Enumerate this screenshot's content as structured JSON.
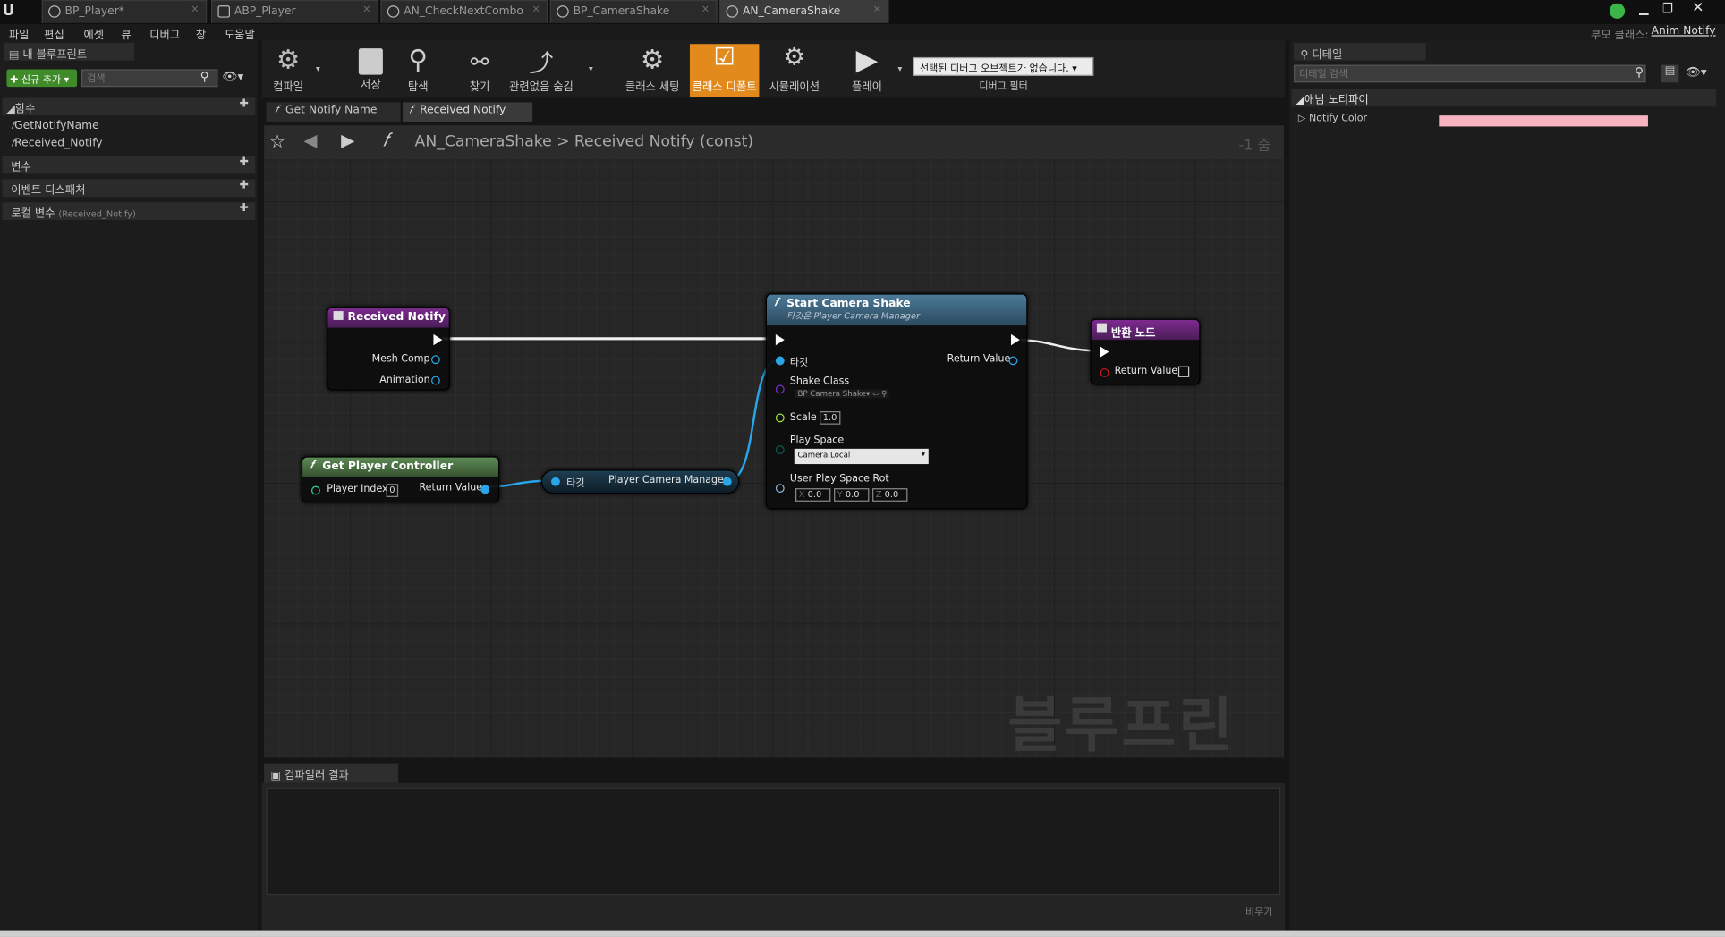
{
  "tabs": [
    {
      "label": "BP_Player*"
    },
    {
      "label": "ABP_Player"
    },
    {
      "label": "AN_CheckNextCombo"
    },
    {
      "label": "BP_CameraShake"
    },
    {
      "label": "AN_CameraShake"
    }
  ],
  "parent_class_label": "부모 클래스:",
  "parent_class_value": "Anim Notify",
  "menu": [
    "파일",
    "편집",
    "에셋",
    "뷰",
    "디버그",
    "창",
    "도움말"
  ],
  "my_blueprint": {
    "title": "내 블루프린트",
    "add_new": "신규 추가",
    "search_placeholder": "검색",
    "functions_label": "함수",
    "functions": [
      "GetNotifyName",
      "Received_Notify"
    ],
    "variables_label": "변수",
    "dispatchers_label": "이벤트 디스패처",
    "local_vars_label": "로컬 변수",
    "local_vars_scope": "(Received_Notify)"
  },
  "toolbar": {
    "compile": "컴파일",
    "save": "저장",
    "browse": "탐색",
    "find": "찾기",
    "hide_unrelated": "관련없음 숨김",
    "class_settings": "클래스 세팅",
    "class_defaults": "클래스 디폴트",
    "simulation": "시뮬레이션",
    "play": "플레이",
    "debug_object": "선택된 디버그 오브젝트가 없습니다.",
    "debug_filter": "디버그 필터"
  },
  "graph_tabs": [
    "Get Notify Name",
    "Received Notify"
  ],
  "breadcrumb": {
    "blueprint": "AN_CameraShake",
    "sep": ">",
    "func": "Received Notify (const)",
    "zoom": "-1 줌"
  },
  "watermark": "블루프린트",
  "nodes": {
    "received": {
      "title": "Received Notify",
      "pins": [
        "Mesh Comp",
        "Animation"
      ]
    },
    "gpc": {
      "title": "Get Player Controller",
      "player_index": "Player Index",
      "player_index_value": "0",
      "return": "Return Value"
    },
    "pcm": {
      "target": "타깃",
      "label": "Player Camera Manager"
    },
    "shake": {
      "title": "Start Camera Shake",
      "subtitle": "타깃은 Player Camera Manager",
      "target": "타깃",
      "return": "Return Value",
      "shake_class": "Shake Class",
      "shake_class_value": "BP Camera Shake",
      "scale": "Scale",
      "scale_value": "1.0",
      "play_space": "Play Space",
      "play_space_value": "Camera Local",
      "rot": "User Play Space Rot",
      "x": "0.0",
      "y": "0.0",
      "z": "0.0"
    },
    "ret": {
      "title": "반환 노드",
      "return": "Return Value"
    }
  },
  "compiler": {
    "title": "컴파일러 결과",
    "clear": "비우기"
  },
  "details": {
    "title": "디테일",
    "search_placeholder": "디테일 검색",
    "category": "애님 노티파이",
    "notify_color_label": "Notify Color",
    "notify_color": "#f7b3c0"
  }
}
